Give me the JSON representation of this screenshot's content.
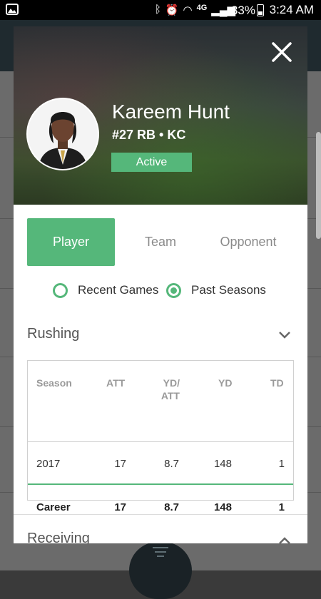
{
  "status_bar": {
    "battery": "33%",
    "time": "3:24 AM",
    "network": "4G"
  },
  "player": {
    "name": "Kareem Hunt",
    "meta": "#27 RB • KC",
    "status": "Active"
  },
  "tabs": [
    {
      "label": "Player",
      "selected": true
    },
    {
      "label": "Team",
      "selected": false
    },
    {
      "label": "Opponent",
      "selected": false
    }
  ],
  "filters": [
    {
      "label": "Recent Games",
      "selected": false
    },
    {
      "label": "Past Seasons",
      "selected": true
    }
  ],
  "sections": {
    "rushing": {
      "title": "Rushing",
      "columns": [
        "Season",
        "ATT",
        "YD/ ATT",
        "YD",
        "TD"
      ],
      "rows": [
        {
          "season": "2017",
          "att": "17",
          "yd_att": "8.7",
          "yd": "148",
          "td": "1"
        },
        {
          "season": "Career",
          "att": "17",
          "yd_att": "8.7",
          "yd": "148",
          "td": "1"
        }
      ]
    },
    "receiving": {
      "title": "Receiving"
    }
  },
  "colors": {
    "accent": "#55b77a",
    "header_bg": "#1f2a2f"
  }
}
